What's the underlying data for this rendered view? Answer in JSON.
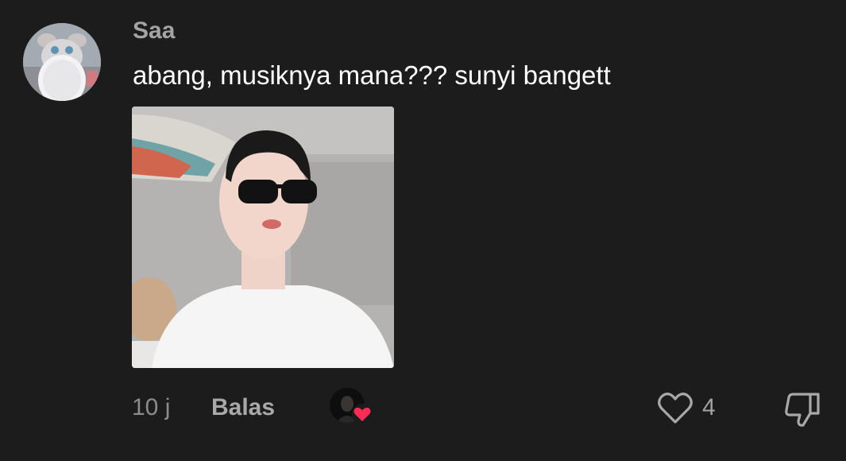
{
  "comment": {
    "username": "Saa",
    "text": "abang, musiknya mana??? sunyi bangett",
    "timestamp": "10 j",
    "reply_label": "Balas",
    "like_count": "4",
    "liked_by_creator": true
  },
  "icons": {
    "like": "heart-outline-icon",
    "dislike": "thumbs-down-outline-icon",
    "creator_like_badge": "red-heart-icon"
  },
  "colors": {
    "background": "#1c1c1c",
    "username": "#a3a3a3",
    "comment_text": "#ffffff",
    "meta_text": "#8c8c8c",
    "creator_heart": "#fe2c55"
  }
}
